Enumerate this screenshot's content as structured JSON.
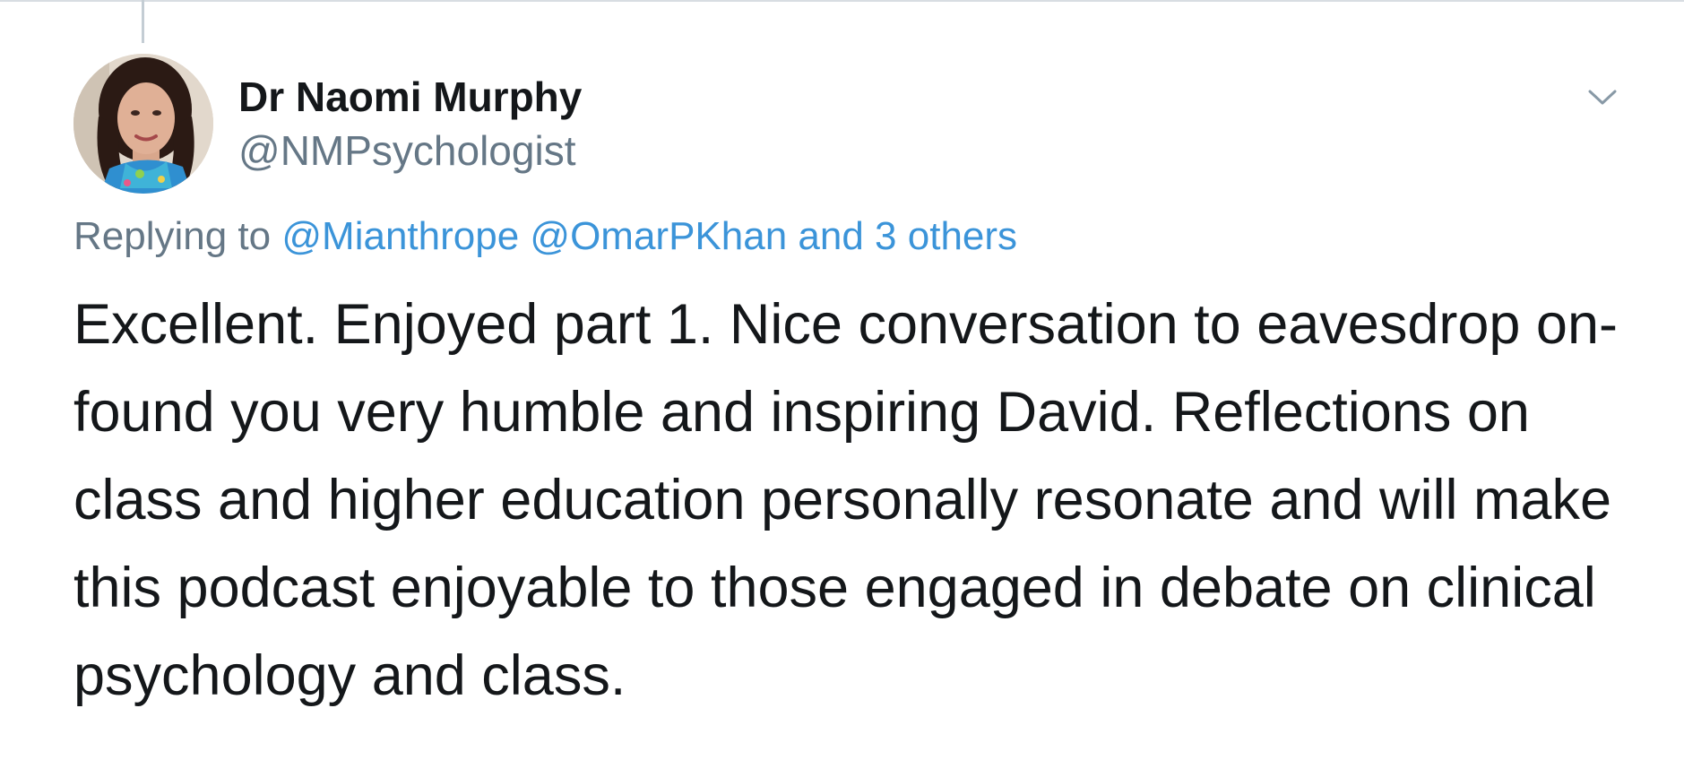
{
  "tweet": {
    "author": {
      "display_name": "Dr Naomi Murphy",
      "handle": "@NMPsychologist",
      "avatar_icon": "profile-photo"
    },
    "reply": {
      "prefix": "Replying to",
      "mentions": [
        "@Mianthrope",
        "@OmarPKhan"
      ],
      "others": "and 3 others"
    },
    "text": "Excellent. Enjoyed part 1. Nice conversation to eavesdrop on- found you very humble and inspiring David. Reflections on class and higher education personally resonate and will make this podcast enjoyable to those engaged in debate on clinical psychology and class.",
    "menu_icon": "chevron-down-icon"
  },
  "colors": {
    "text": "#14171a",
    "secondary": "#657786",
    "link": "#3b94d9",
    "thread_line": "#c4cdd4"
  }
}
